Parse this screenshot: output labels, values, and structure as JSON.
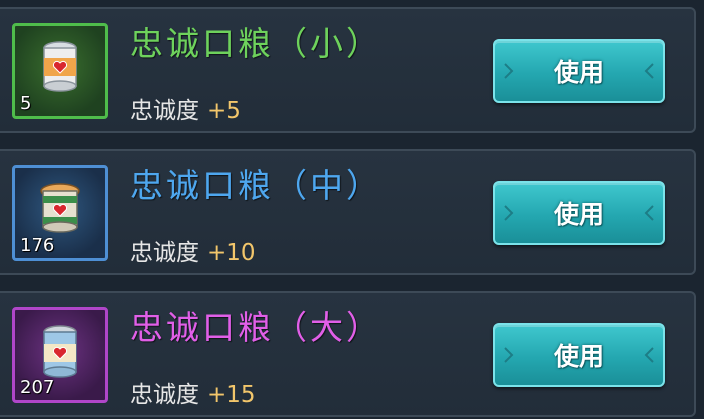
{
  "items": [
    {
      "name": "忠诚口粮（小）",
      "count": "5",
      "stat_label": "忠诚度",
      "stat_value": "+5",
      "rarity": "green",
      "color": "#6ed25c",
      "button_label": "使用",
      "icon": "ration-can-icon"
    },
    {
      "name": "忠诚口粮（中）",
      "count": "176",
      "stat_label": "忠诚度",
      "stat_value": "+10",
      "rarity": "blue",
      "color": "#4ea7ef",
      "button_label": "使用",
      "icon": "ration-can-icon"
    },
    {
      "name": "忠诚口粮（大）",
      "count": "207",
      "stat_label": "忠诚度",
      "stat_value": "+15",
      "rarity": "purple",
      "color": "#e15fe8",
      "button_label": "使用",
      "icon": "ration-can-icon"
    }
  ]
}
